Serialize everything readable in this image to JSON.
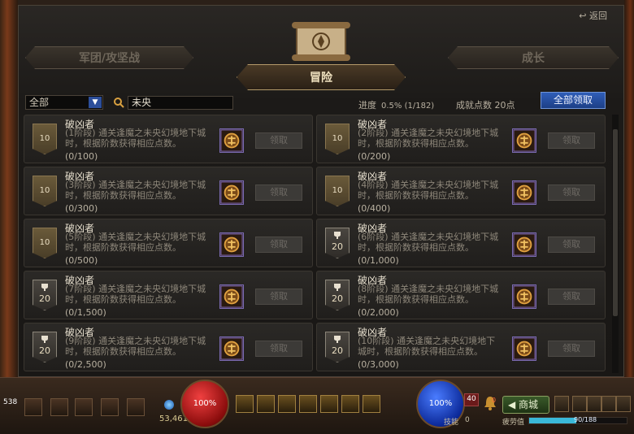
{
  "window": {
    "return_label": "返回",
    "tabs": {
      "left": "军团/攻坚战",
      "center": "冒险",
      "right": "成长"
    }
  },
  "filter": {
    "selected": "全部",
    "search_value": "未央"
  },
  "progress": {
    "label": "进度",
    "value": "0.5% (1/182)"
  },
  "points": {
    "label": "成就点数",
    "value": "20点"
  },
  "claim_all_label": "全部领取",
  "cards": [
    {
      "title": "破凶者",
      "desc": "(1阶段) 通关逢魔之未央幻境地下城时，根据阶数获得相应点数。",
      "count": "(0/100)",
      "badge": "10",
      "trophy": false,
      "claim": "领取"
    },
    {
      "title": "破凶者",
      "desc": "(2阶段) 通关逢魔之未央幻境地下城时，根据阶数获得相应点数。",
      "count": "(0/200)",
      "badge": "10",
      "trophy": false,
      "claim": "领取"
    },
    {
      "title": "破凶者",
      "desc": "(3阶段) 通关逢魔之未央幻境地下城时，根据阶数获得相应点数。",
      "count": "(0/300)",
      "badge": "10",
      "trophy": false,
      "claim": "领取"
    },
    {
      "title": "破凶者",
      "desc": "(4阶段) 通关逢魔之未央幻境地下城时，根据阶数获得相应点数。",
      "count": "(0/400)",
      "badge": "10",
      "trophy": false,
      "claim": "领取"
    },
    {
      "title": "破凶者",
      "desc": "(5阶段) 通关逢魔之未央幻境地下城时，根据阶数获得相应点数。",
      "count": "(0/500)",
      "badge": "10",
      "trophy": false,
      "claim": "领取"
    },
    {
      "title": "破凶者",
      "desc": "(6阶段) 通关逢魔之未央幻境地下城时，根据阶数获得相应点数。",
      "count": "(0/1,000)",
      "badge": "20",
      "trophy": true,
      "claim": "领取"
    },
    {
      "title": "破凶者",
      "desc": "(7阶段) 通关逢魔之未央幻境地下城时，根据阶数获得相应点数。",
      "count": "(0/1,500)",
      "badge": "20",
      "trophy": true,
      "claim": "领取"
    },
    {
      "title": "破凶者",
      "desc": "(8阶段) 通关逢魔之未央幻境地下城时，根据阶数获得相应点数。",
      "count": "(0/2,000)",
      "badge": "20",
      "trophy": true,
      "claim": "领取"
    },
    {
      "title": "破凶者",
      "desc": "(9阶段) 通关逢魔之未央幻境地下城时，根据阶数获得相应点数。",
      "count": "(0/2,500)",
      "badge": "20",
      "trophy": true,
      "claim": "领取"
    },
    {
      "title": "破凶者",
      "desc": "(10阶段) 通关逢魔之未央幻境地下城时，根据阶数获得相应点数。",
      "count": "(0/3,000)",
      "badge": "20",
      "trophy": true,
      "claim": "领取"
    }
  ],
  "hud": {
    "portrait_num": "538",
    "hp": "100%",
    "mp": "100%",
    "gold": "53,461",
    "level": "40",
    "skill_label": "技能",
    "skill_points": "0",
    "bell_count": "0",
    "shop_label": "商城",
    "fatigue_label": "疲劳值",
    "fatigue_value": "90/188",
    "fatigue_ratio": 0.48
  }
}
